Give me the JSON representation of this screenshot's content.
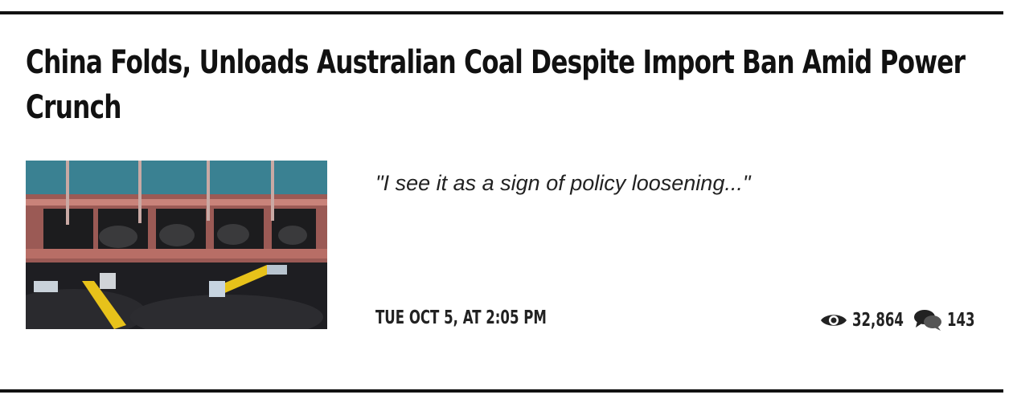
{
  "article": {
    "title": "China Folds, Unloads Australian Coal Despite Import Ban Amid Power Crunch",
    "teaser": "\"I see it as a sign of policy loosening...\"",
    "date": "TUE OCT 5, AT 2:05 PM",
    "views": "32,864",
    "comments": "143"
  },
  "icons": {
    "views": "eye-icon",
    "comments": "chat-bubbles-icon"
  },
  "colors": {
    "text": "#111111",
    "rule": "#111111"
  }
}
